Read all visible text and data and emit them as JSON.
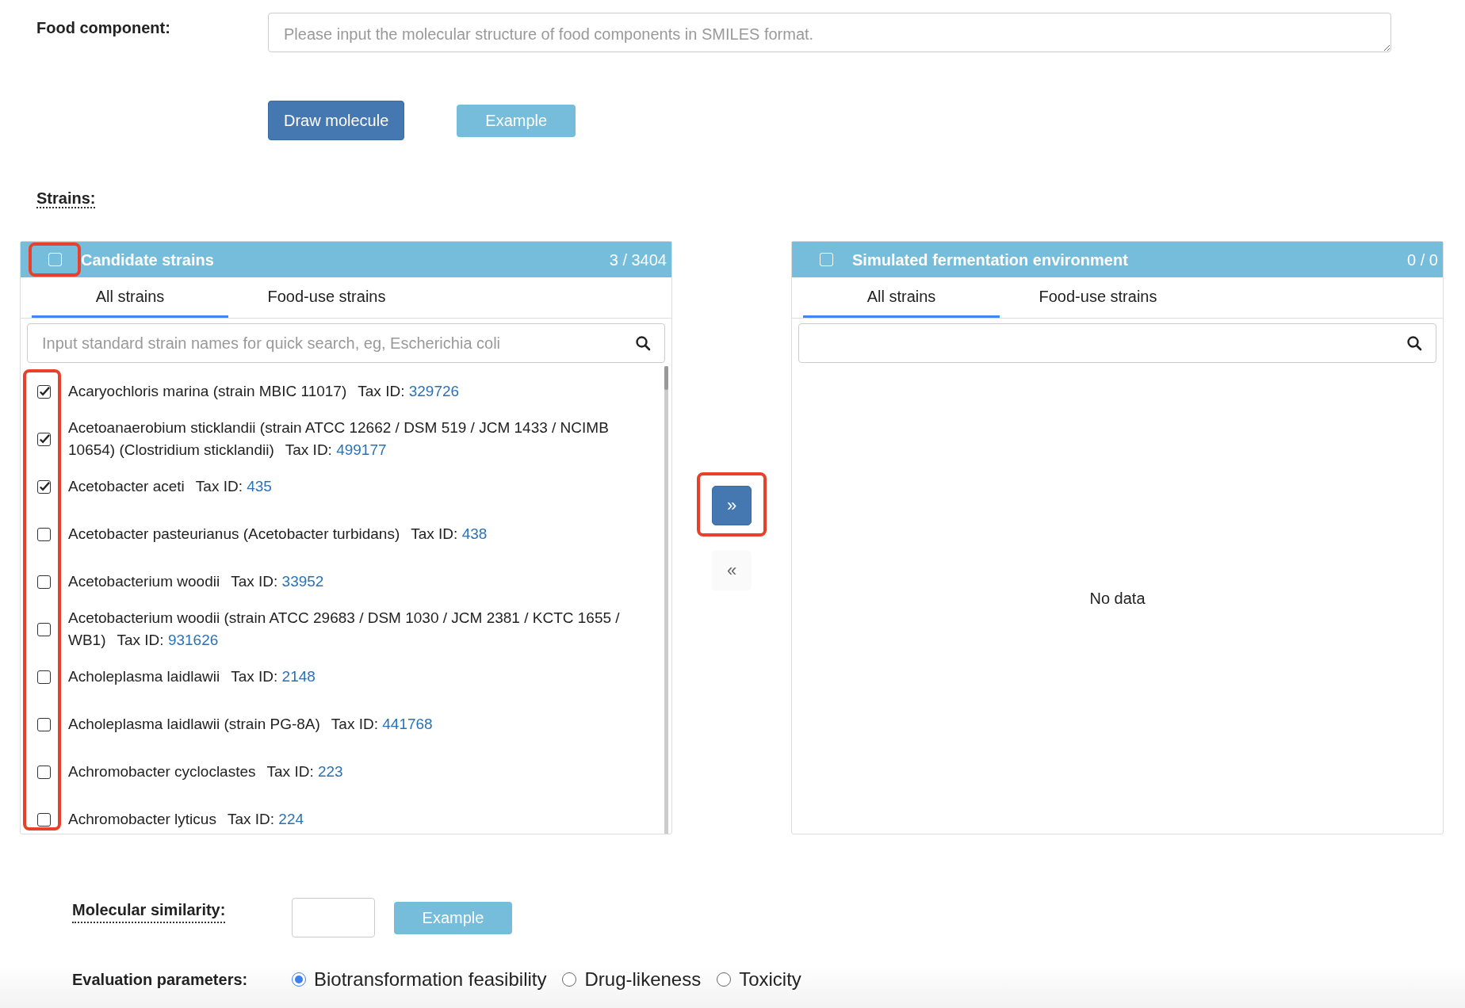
{
  "food_component": {
    "label": "Food component:",
    "placeholder": "Please input the molecular structure of food components in SMILES format."
  },
  "molecule_buttons": [
    {
      "label": "Draw molecule",
      "kind": "primary"
    },
    {
      "label": "Example",
      "kind": "info"
    }
  ],
  "strains_label": "Strains:",
  "transfer": {
    "panels": [
      {
        "title": "Candidate strains",
        "count": "3 / 3404",
        "header_checkbox": {
          "checked": false,
          "highlighted": true
        },
        "tabs": [
          {
            "label": "All strains",
            "selected": true
          },
          {
            "label": "Food-use strains",
            "selected": false
          }
        ],
        "search": {
          "placeholder": "Input standard strain names for quick search, eg, Escherichia coli"
        },
        "checkbox_column_highlighted": true,
        "items": [
          {
            "name": "Acaryochloris marina (strain MBIC 11017)",
            "tax_label": "Tax ID:",
            "tax_id": "329726",
            "checked": true
          },
          {
            "name": "Acetoanaerobium sticklandii (strain ATCC 12662 / DSM 519 / JCM 1433 / NCIMB 10654) (Clostridium sticklandii)",
            "tax_label": "Tax ID:",
            "tax_id": "499177",
            "checked": true
          },
          {
            "name": "Acetobacter aceti",
            "tax_label": "Tax ID:",
            "tax_id": "435",
            "checked": true
          },
          {
            "name": "Acetobacter pasteurianus (Acetobacter turbidans)",
            "tax_label": "Tax ID:",
            "tax_id": "438",
            "checked": false
          },
          {
            "name": "Acetobacterium woodii",
            "tax_label": "Tax ID:",
            "tax_id": "33952",
            "checked": false
          },
          {
            "name": "Acetobacterium woodii (strain ATCC 29683 / DSM 1030 / JCM 2381 / KCTC 1655 / WB1)",
            "tax_label": "Tax ID:",
            "tax_id": "931626",
            "checked": false
          },
          {
            "name": "Acholeplasma laidlawii",
            "tax_label": "Tax ID:",
            "tax_id": "2148",
            "checked": false
          },
          {
            "name": "Acholeplasma laidlawii (strain PG-8A)",
            "tax_label": "Tax ID:",
            "tax_id": "441768",
            "checked": false
          },
          {
            "name": "Achromobacter cycloclastes",
            "tax_label": "Tax ID:",
            "tax_id": "223",
            "checked": false
          },
          {
            "name": "Achromobacter lyticus",
            "tax_label": "Tax ID:",
            "tax_id": "224",
            "checked": false
          }
        ]
      },
      {
        "title": "Simulated fermentation environment",
        "count": "0 / 0",
        "header_checkbox": {
          "checked": false
        },
        "tabs": [
          {
            "label": "All strains",
            "selected": true
          },
          {
            "label": "Food-use strains",
            "selected": false
          }
        ],
        "empty_text": "No data"
      }
    ],
    "buttons": [
      {
        "label": "»",
        "kind": "primary",
        "highlighted": true
      },
      {
        "label": "«",
        "kind": "disabled"
      }
    ]
  },
  "similarity": {
    "label": "Molecular similarity:",
    "button": "Example"
  },
  "evaluation": {
    "label": "Evaluation parameters:",
    "options": [
      {
        "label": "Biotransformation feasibility",
        "selected": true
      },
      {
        "label": "Drug-likeness",
        "selected": false
      },
      {
        "label": "Toxicity",
        "selected": false
      }
    ]
  }
}
